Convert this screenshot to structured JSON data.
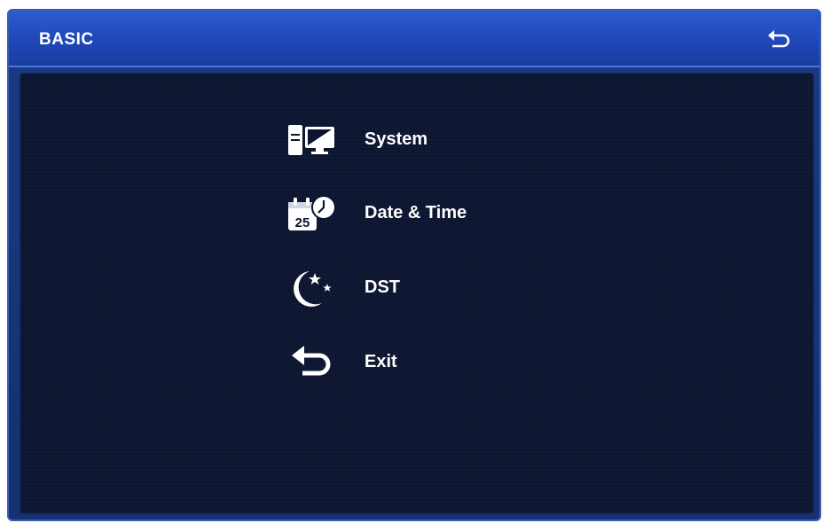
{
  "header": {
    "title": "BASIC",
    "back_icon": "back-arrow-icon"
  },
  "menu": {
    "items": [
      {
        "label": "System",
        "icon": "computer-icon"
      },
      {
        "label": "Date & Time",
        "icon": "calendar-clock-icon",
        "icon_text": "25"
      },
      {
        "label": "DST",
        "icon": "moon-stars-icon"
      },
      {
        "label": "Exit",
        "icon": "back-arrow-icon"
      }
    ]
  },
  "colors": {
    "titlebar": "#1e48b8",
    "background": "#0c1530",
    "text": "#ffffff"
  }
}
